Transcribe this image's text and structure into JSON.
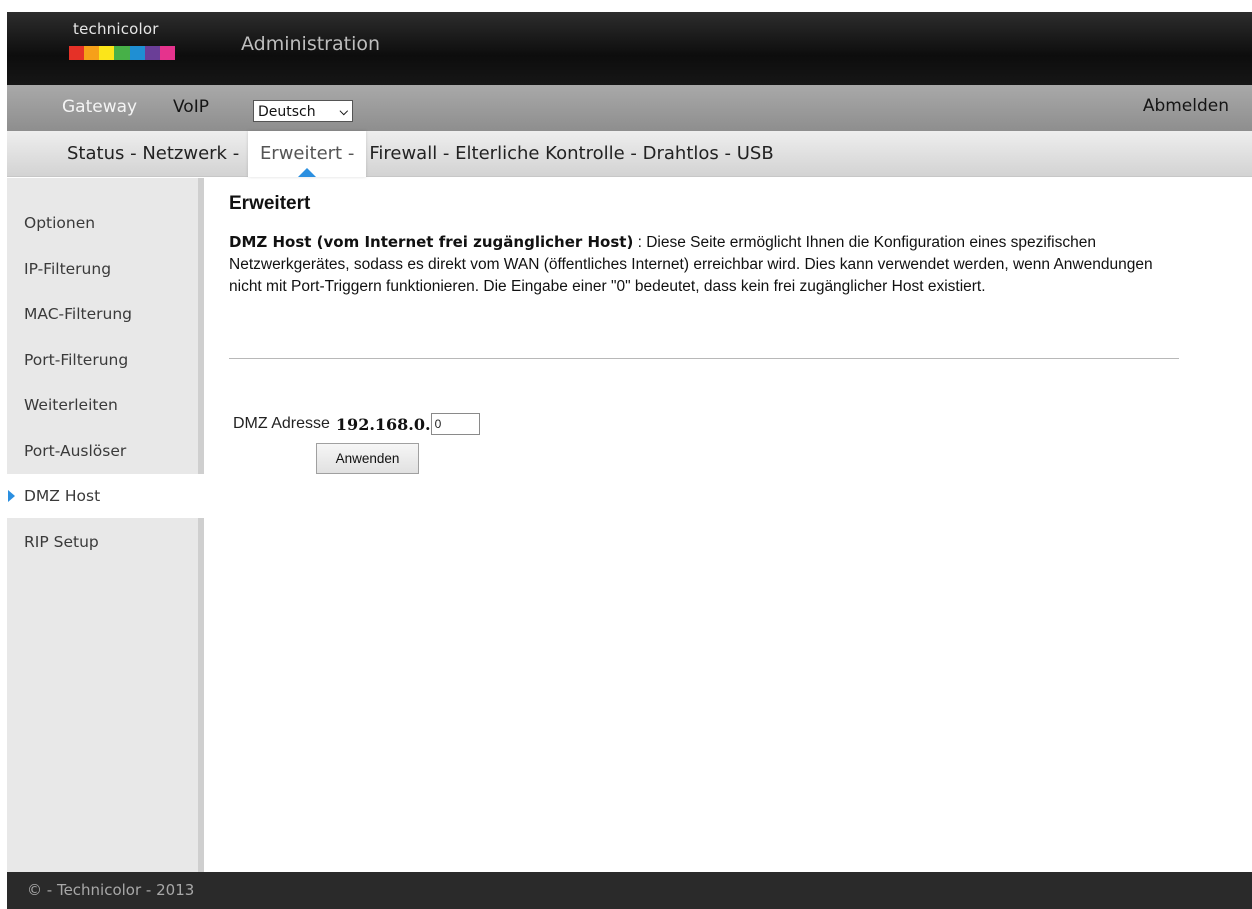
{
  "header": {
    "brand": "technicolor",
    "title": "Administration",
    "brand_colors": [
      "#e53127",
      "#f6a019",
      "#fbe51a",
      "#47b048",
      "#1f8fd3",
      "#6a3e97",
      "#e5338d"
    ]
  },
  "top_nav": {
    "gateway": "Gateway",
    "voip": "VoIP",
    "language": "Deutsch",
    "logout": "Abmelden"
  },
  "menu": {
    "items": [
      {
        "label": "Status -",
        "active": false
      },
      {
        "label": "Netzwerk -",
        "active": false
      },
      {
        "label": "Erweitert -",
        "active": true
      },
      {
        "label": "Firewall -",
        "active": false
      },
      {
        "label": "Elterliche Kontrolle -",
        "active": false
      },
      {
        "label": "Drahtlos -",
        "active": false
      },
      {
        "label": "USB",
        "active": false
      }
    ]
  },
  "sidebar": {
    "items": [
      {
        "label": "Optionen"
      },
      {
        "label": "IP-Filterung"
      },
      {
        "label": "MAC-Filterung"
      },
      {
        "label": "Port-Filterung"
      },
      {
        "label": "Weiterleiten"
      },
      {
        "label": "Port-Auslöser"
      },
      {
        "label": "DMZ Host",
        "active": true
      },
      {
        "label": "RIP Setup"
      }
    ]
  },
  "main": {
    "title": "Erweitert",
    "desc_bold": "DMZ Host (vom Internet frei zugänglicher Host)",
    "desc_text": "  :  Diese Seite ermöglicht Ihnen die Konfiguration eines spezifischen Netzwerkgerätes, sodass es direkt vom WAN (öffentliches Internet) erreichbar wird. Dies kann verwendet werden, wenn Anwendungen nicht mit Port-Triggern funktionieren. Die Eingabe einer \"0\" bedeutet, dass kein frei zugänglicher Host existiert.",
    "dmz_label": "DMZ Adresse",
    "dmz_prefix": "192.168.0.",
    "dmz_value": "0",
    "apply_label": "Anwenden"
  },
  "footer": {
    "text": "© - Technicolor - 2013"
  },
  "colors": {
    "accent": "#2b8fe0"
  }
}
